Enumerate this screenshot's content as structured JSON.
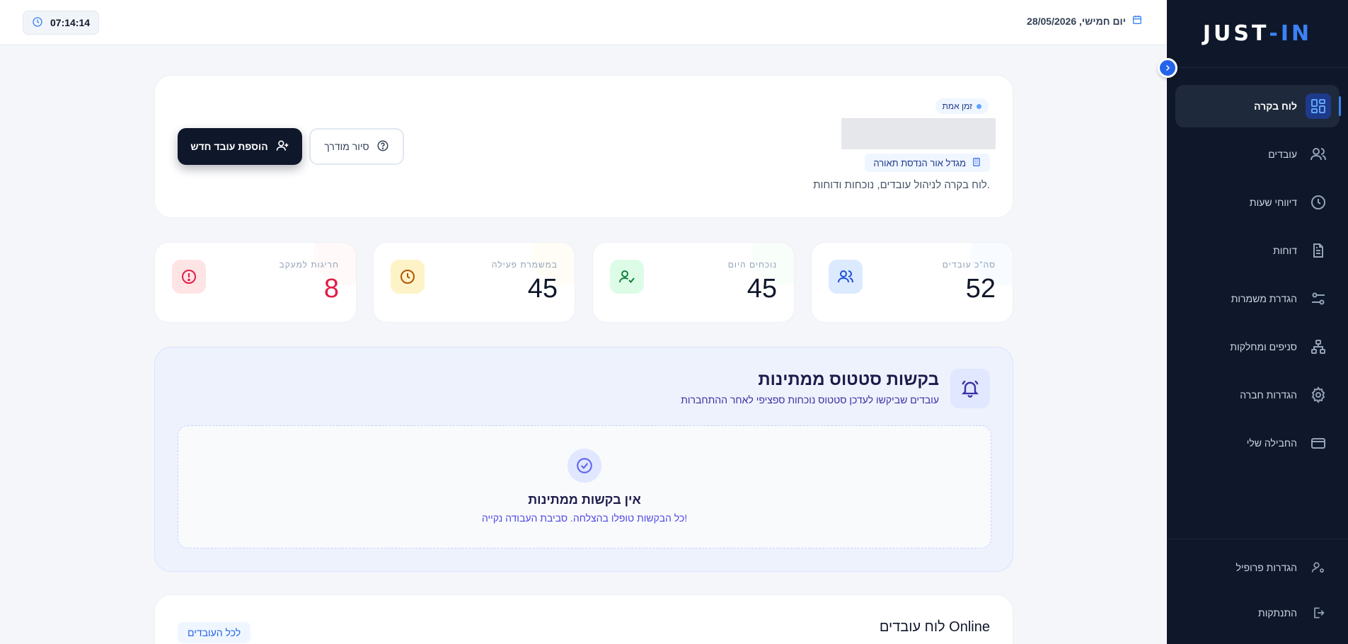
{
  "brand": {
    "logo_main": "JUST",
    "logo_sep": "-",
    "logo_accent": "IN"
  },
  "colors": {
    "sidebar_bg": "#0f172a",
    "accent": "#3b82f6",
    "primary_button": "#0f172a",
    "requests_bg": "#eef2fd"
  },
  "sidebar": {
    "items": [
      {
        "label": "לוח בקרה",
        "icon": "dashboard-grid-icon",
        "active": true
      },
      {
        "label": "עובדים",
        "icon": "users-icon"
      },
      {
        "label": "דיווחי שעות",
        "icon": "clock-icon"
      },
      {
        "label": "דוחות",
        "icon": "document-icon"
      },
      {
        "label": "הגדרת משמרות",
        "icon": "sliders-icon"
      },
      {
        "label": "סניפים ומחלקות",
        "icon": "org-chart-icon"
      },
      {
        "label": "הגדרות חברה",
        "icon": "gear-icon"
      },
      {
        "label": "החבילה שלי",
        "icon": "credit-card-icon"
      }
    ],
    "bottom": [
      {
        "label": "הגדרות פרופיל",
        "icon": "user-settings-icon"
      },
      {
        "label": "התנתקות",
        "icon": "logout-icon"
      }
    ]
  },
  "topbar": {
    "clock": "07:14:14",
    "date": "יום חמישי, 28/05/2026"
  },
  "header": {
    "realtime_badge": "זמן אמת",
    "company": "מגדל אור הנדסת תאורה",
    "subtitle": "לוח בקרה לניהול עובדים, נוכחות ודוחות.",
    "add_employee_button": "הוספת עובד חדש",
    "guided_tour_button": "סיור מודרך"
  },
  "stats": [
    {
      "label": "סה\"כ עובדים",
      "value": "52",
      "icon": "users-icon",
      "color": "#1d4ed8",
      "bg": "#dbeafe"
    },
    {
      "label": "נוכחים היום",
      "value": "45",
      "icon": "user-check-icon",
      "color": "#15803d",
      "bg": "#dcfce7"
    },
    {
      "label": "במשמרת פעילה",
      "value": "45",
      "icon": "clock-icon",
      "color": "#b45309",
      "bg": "#fef3c7"
    },
    {
      "label": "חריגות למעקב",
      "value": "8",
      "icon": "alert-icon",
      "color": "#e11d48",
      "bg": "#ffe4e6"
    }
  ],
  "requests": {
    "title": "בקשות סטטוס ממתינות",
    "subtitle": "עובדים שביקשו לעדכן סטטוס נוכחות ספציפי לאחר ההתחברות",
    "empty_title": "אין בקשות ממתינות",
    "empty_subtitle": "כל הבקשות טופלו בהצלחה. סביבת העבודה נקייה!"
  },
  "online_board": {
    "title": "לוח עובדים Online",
    "all_button": "לכל העובדים"
  }
}
